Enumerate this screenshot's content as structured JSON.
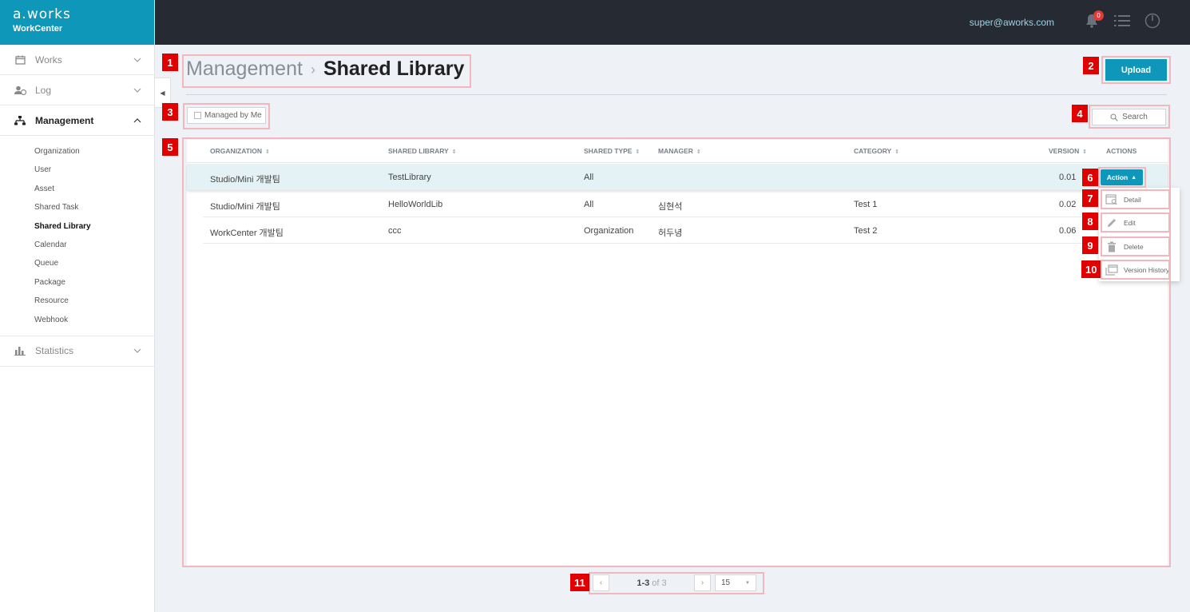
{
  "brand": {
    "logo": "a.works",
    "name": "WorkCenter"
  },
  "topbar": {
    "user_email": "super@aworks.com",
    "notification_count": "0"
  },
  "sidebar": {
    "items": [
      {
        "label": "Works",
        "icon": "calendar-icon"
      },
      {
        "label": "Log",
        "icon": "user-log-icon"
      },
      {
        "label": "Management",
        "icon": "org-tree-icon"
      },
      {
        "label": "Statistics",
        "icon": "bar-chart-icon"
      }
    ],
    "management_sub": [
      "Organization",
      "User",
      "Asset",
      "Shared Task",
      "Shared Library",
      "Calendar",
      "Queue",
      "Package",
      "Resource",
      "Webhook"
    ],
    "selected_sub": "Shared Library"
  },
  "page": {
    "breadcrumb_parent": "Management",
    "breadcrumb_sep": "›",
    "title": "Shared Library",
    "upload_label": "Upload",
    "managed_by_me_label": "Managed by Me",
    "search_label": "Search"
  },
  "table": {
    "headers": [
      "ORGANIZATION",
      "SHARED LIBRARY",
      "SHARED TYPE",
      "MANAGER",
      "CATEGORY",
      "VERSION",
      "ACTIONS"
    ],
    "rows": [
      {
        "organization": "Studio/Mini 개발팀",
        "library": "TestLibrary",
        "type": "All",
        "manager": "",
        "category": "",
        "version": "0.01"
      },
      {
        "organization": "Studio/Mini 개발팀",
        "library": "HelloWorldLib",
        "type": "All",
        "manager": "심현석",
        "category": "Test 1",
        "version": "0.02"
      },
      {
        "organization": "WorkCenter 개발팀",
        "library": "ccc",
        "type": "Organization",
        "manager": "허두녕",
        "category": "Test 2",
        "version": "0.06"
      }
    ]
  },
  "action_menu": {
    "button_label": "Action",
    "items": [
      {
        "label": "Detail",
        "icon": "detail-icon"
      },
      {
        "label": "Edit",
        "icon": "pencil-icon"
      },
      {
        "label": "Delete",
        "icon": "trash-icon"
      },
      {
        "label": "Version History",
        "icon": "history-icon"
      }
    ]
  },
  "pagination": {
    "range": "1-3",
    "of_text": "of 3",
    "page_size": "15"
  },
  "annotations": [
    "1",
    "2",
    "3",
    "4",
    "5",
    "6",
    "7",
    "8",
    "9",
    "10",
    "11"
  ],
  "colors": {
    "accent": "#0e97b8",
    "topbar": "#262a33",
    "annotation_red": "#e00000",
    "annotation_box": "#f2b7bd"
  }
}
